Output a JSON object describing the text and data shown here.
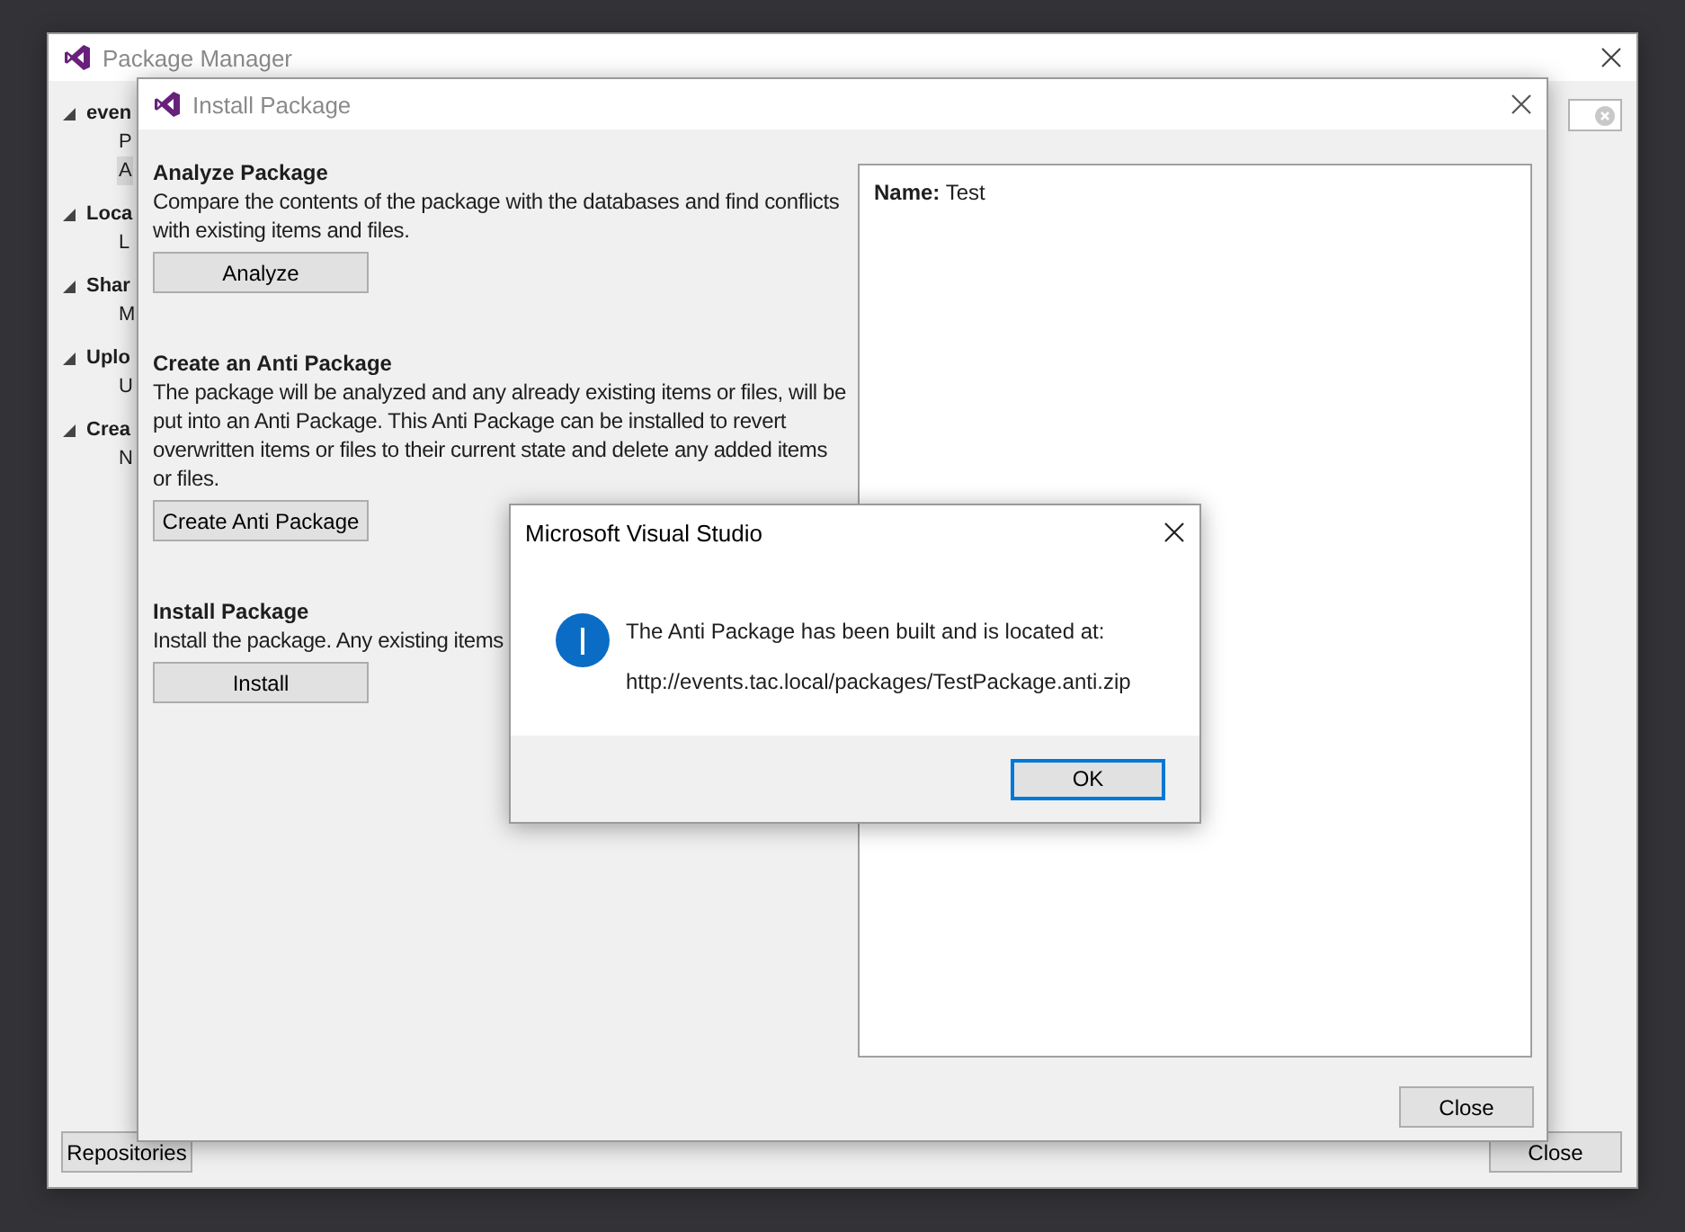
{
  "package_manager": {
    "title": "Package Manager",
    "tree": [
      {
        "label": "even",
        "expanded": true,
        "children": [
          {
            "label": "P",
            "selected": false
          },
          {
            "label": "A",
            "selected": true
          }
        ]
      },
      {
        "label": "Loca",
        "expanded": true,
        "children": [
          {
            "label": "L",
            "selected": false
          }
        ]
      },
      {
        "label": "Shar",
        "expanded": true,
        "children": [
          {
            "label": "M",
            "selected": false
          }
        ]
      },
      {
        "label": "Uplo",
        "expanded": true,
        "children": [
          {
            "label": "U",
            "selected": false
          }
        ]
      },
      {
        "label": "Crea",
        "expanded": true,
        "children": [
          {
            "label": "N",
            "selected": false
          }
        ]
      }
    ],
    "buttons": [
      "Repositories",
      "Close"
    ]
  },
  "install_package": {
    "title": "Install Package",
    "sections": [
      {
        "heading": "Analyze Package",
        "description": "Compare the contents of the package with the databases and find conflicts with existing items and files.",
        "button": "Analyze"
      },
      {
        "heading": "Create an Anti Package",
        "description": "The package will be analyzed and any already existing items or files, will be put into an Anti Package. This Anti Package can be installed to revert overwritten items or files to their current state and delete any added items or files.",
        "button": "Create Anti Package"
      },
      {
        "heading": "Install Package",
        "description": "Install the package. Any existing items",
        "button": "Install"
      }
    ],
    "details": {
      "label": "Name:",
      "value": "Test"
    },
    "close": "Close"
  },
  "message_box": {
    "title": "Microsoft Visual Studio",
    "lines": [
      "The Anti Package has been built and is located at:",
      "http://events.tac.local/packages/TestPackage.anti.zip"
    ],
    "button": "OK"
  }
}
